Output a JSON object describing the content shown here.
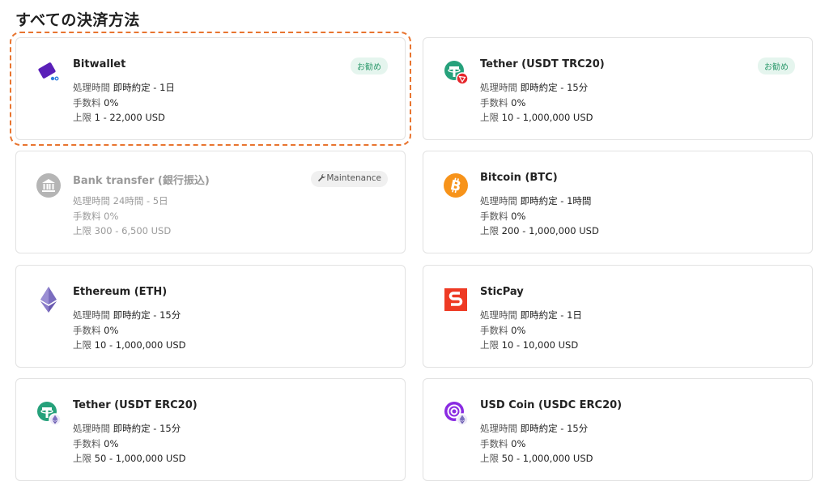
{
  "page": {
    "title": "すべての決済方法"
  },
  "labels": {
    "time": "処理時間",
    "fee": "手数料",
    "limit": "上限"
  },
  "methods": [
    {
      "name": "Bitwallet",
      "time": "即時約定 - 1日",
      "fee": "0%",
      "limit": "1 - 22,000 USD",
      "badge": "お勧め",
      "icon": "bitwallet-logo-icon",
      "selected": true
    },
    {
      "name": "Tether (USDT TRC20)",
      "time": "即時約定 - 15分",
      "fee": "0%",
      "limit": "10 - 1,000,000 USD",
      "badge": "お勧め",
      "icon": "tether-trc20-icon"
    },
    {
      "name": "Bank transfer (銀行振込)",
      "time": "24時間 - 5日",
      "fee": "0%",
      "limit": "300 - 6,500 USD",
      "badge": "Maintenance",
      "badge_icon": "wrench-icon",
      "icon": "bank-icon",
      "disabled": true
    },
    {
      "name": "Bitcoin (BTC)",
      "time": "即時約定 - 1時間",
      "fee": "0%",
      "limit": "200 - 1,000,000 USD",
      "icon": "bitcoin-icon"
    },
    {
      "name": "Ethereum (ETH)",
      "time": "即時約定 - 15分",
      "fee": "0%",
      "limit": "10 - 1,000,000 USD",
      "icon": "ethereum-icon"
    },
    {
      "name": "SticPay",
      "time": "即時約定 - 1日",
      "fee": "0%",
      "limit": "10 - 10,000 USD",
      "icon": "sticpay-icon"
    },
    {
      "name": "Tether (USDT ERC20)",
      "time": "即時約定 - 15分",
      "fee": "0%",
      "limit": "50 - 1,000,000 USD",
      "icon": "tether-erc20-icon"
    },
    {
      "name": "USD Coin (USDC ERC20)",
      "time": "即時約定 - 15分",
      "fee": "0%",
      "limit": "50 - 1,000,000 USD",
      "icon": "usdc-erc20-icon"
    }
  ],
  "colors": {
    "accent_selected": "#e8742f",
    "recommend_badge_bg": "#e5f5ee",
    "recommend_badge_text": "#2e9a6d",
    "tether": "#26a17b",
    "tron": "#e5262b",
    "bitcoin": "#f7931a",
    "ethereum": "#627eea",
    "sticpay": "#ee3a24",
    "usdc": "#8a2be2",
    "bitwallet": "#5a1fb8"
  }
}
